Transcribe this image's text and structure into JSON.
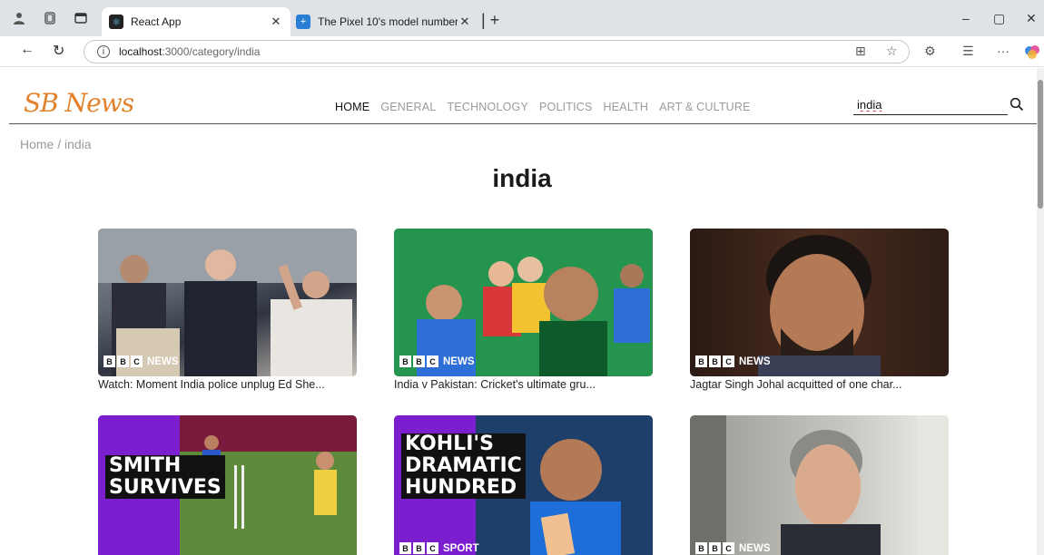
{
  "browser": {
    "tabs": [
      {
        "title": "React App",
        "active": true
      },
      {
        "title": "The Pixel 10's model number mig",
        "active": false
      }
    ],
    "url_host": "localhost",
    "url_path": ":3000/category/india"
  },
  "site": {
    "logo": "SB News",
    "nav": [
      "HOME",
      "GENERAL",
      "TECHNOLOGY",
      "POLITICS",
      "HEALTH",
      "ART & CULTURE"
    ],
    "active_nav": "HOME",
    "search_value": "india"
  },
  "breadcrumb": "Home / india",
  "page_title": "india",
  "articles": [
    {
      "title": "Watch: Moment India police unplug Ed She...",
      "source_badge": "NEWS",
      "overlay": ""
    },
    {
      "title": "India v Pakistan: Cricket's ultimate gru...",
      "source_badge": "NEWS",
      "overlay": ""
    },
    {
      "title": "Jagtar Singh Johal acquitted of one char...",
      "source_badge": "NEWS",
      "overlay": ""
    },
    {
      "title": "",
      "source_badge": "",
      "overlay": "SMITH\nSURVIVES"
    },
    {
      "title": "",
      "source_badge": "SPORT",
      "overlay": "KOHLI'S\nDRAMATIC\nHUNDRED"
    },
    {
      "title": "",
      "source_badge": "NEWS",
      "overlay": ""
    }
  ],
  "bbc_letters": [
    "B",
    "B",
    "C"
  ],
  "colors": {
    "logo": "#e2812b",
    "nav_active": "#111111",
    "nav_inactive": "#9a9a9a",
    "overlay_purple": "#6a1bbf"
  }
}
